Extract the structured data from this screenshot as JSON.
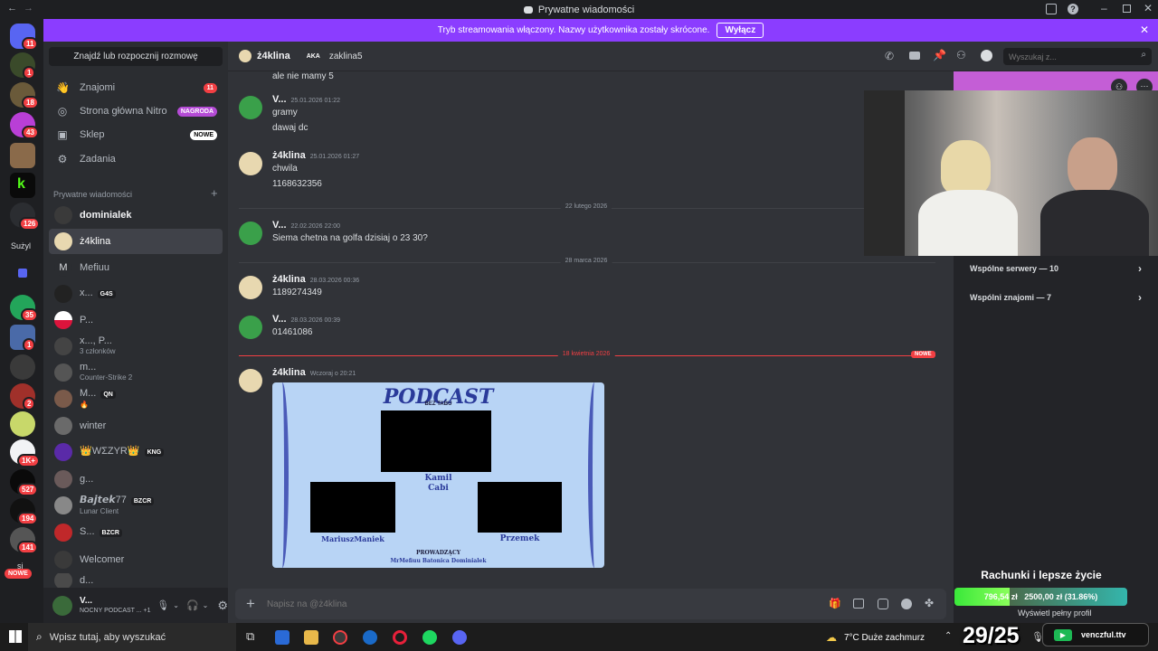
{
  "window": {
    "title": "Prywatne wiadomości"
  },
  "stream_bar": {
    "text": "Tryb streamowania włączony. Nazwy użytkownika zostały skrócone.",
    "button": "Wyłącz"
  },
  "guilds": {
    "badges": [
      "11",
      "1",
      "18",
      "43",
      "126",
      "35",
      "1",
      "2",
      "1K+",
      "527",
      "194",
      "141"
    ],
    "label": "Sużyl",
    "new_label": "NOWE",
    "si": "si"
  },
  "sidebar": {
    "search": "Znajdź lub rozpocznij rozmowę",
    "nav": [
      {
        "label": "Znajomi",
        "badge": "11",
        "icon": "friends-icon"
      },
      {
        "label": "Strona główna Nitro",
        "badge": "NAGRODA",
        "icon": "nitro-icon"
      },
      {
        "label": "Sklep",
        "badge": "NOWE",
        "icon": "shop-icon"
      },
      {
        "label": "Zadania",
        "badge": "",
        "icon": "quests-icon"
      }
    ],
    "dm_header": "Prywatne wiadomości",
    "dms": [
      {
        "name": "dominialek",
        "sub": "",
        "tag": ""
      },
      {
        "name": "ż4klina",
        "sub": "",
        "tag": ""
      },
      {
        "name": "Mefiuu",
        "sub": "",
        "tag": ""
      },
      {
        "name": "x...",
        "sub": "",
        "tag": "G4S"
      },
      {
        "name": "P...",
        "sub": "",
        "tag": ""
      },
      {
        "name": "x..., P...",
        "sub": "3 członków",
        "tag": ""
      },
      {
        "name": "m...",
        "sub": "Counter-Strike 2",
        "tag": ""
      },
      {
        "name": "M...",
        "sub": "🔥",
        "tag": "QN"
      },
      {
        "name": "winter",
        "sub": "",
        "tag": ""
      },
      {
        "name": "👑WΣZYR👑",
        "sub": "",
        "tag": "KNG"
      },
      {
        "name": "g...",
        "sub": "",
        "tag": ""
      },
      {
        "name": "𝘽𝙖𝙟𝙩𝙚𝙠77",
        "sub": "Lunar Client",
        "tag": "BZCR"
      },
      {
        "name": "S...",
        "sub": "",
        "tag": "BZCR"
      },
      {
        "name": "Welcomer",
        "sub": "",
        "tag": ""
      },
      {
        "name": "d...",
        "sub": "",
        "tag": ""
      }
    ],
    "user": {
      "name": "V...",
      "status": "NOCNY PODCAST ...",
      "extra": "+1"
    }
  },
  "header": {
    "name": "ż4klina",
    "aka": "AKA",
    "aka_name": "zaklina5",
    "search_placeholder": "Wyszukaj z..."
  },
  "messages": {
    "top_line": "ale nie mamy 5",
    "m1": {
      "author": "V...",
      "time": "25.01.2026 01:22",
      "lines": [
        "gramy",
        "dawaj dc"
      ]
    },
    "m2": {
      "author": "ż4klina",
      "time": "25.01.2026 01:27",
      "lines": [
        "chwila",
        "1168632356"
      ]
    },
    "d1": "22 lutego 2026",
    "m3": {
      "author": "V...",
      "time": "22.02.2026 22:00",
      "lines": [
        "Siema chetna na golfa dzisiaj o 23 30?"
      ]
    },
    "d2": "28 marca 2026",
    "m4": {
      "author": "ż4klina",
      "time": "28.03.2026 00:36",
      "lines": [
        "1189274349"
      ]
    },
    "m5": {
      "author": "V...",
      "time": "28.03.2026 00:39",
      "lines": [
        "01461086"
      ]
    },
    "d3": "18 kwietnia 2026",
    "d3_badge": "NOWE",
    "m6": {
      "author": "ż4klina",
      "time": "Wczoraj o 20:21"
    }
  },
  "podcast_image": {
    "title": "PODCAST",
    "subtitle": "BEZ TABU",
    "center": "Kamil\nCabi",
    "left": "MariuszManiek",
    "right": "Przemek",
    "hosts_label": "PROWADZĄCY",
    "hosts": "MrMefiuu  Batonica Dominialek"
  },
  "composer": {
    "placeholder": "Napisz na @ż4klina"
  },
  "profile": {
    "mutual_servers": "Wspólne serwery — 10",
    "mutual_friends": "Wspólni znajomi — 7"
  },
  "overlay": {
    "goal_title": "Rachunki i lepsze życie",
    "goal_current": "796,54 zł",
    "goal_target": "2500,00 zł (31.86%)",
    "goal_progress": 0.3186,
    "profile_link": "Wyświetl pełny profil",
    "channel": "venczful.ttv",
    "counter": "29/25"
  },
  "taskbar": {
    "search_placeholder": "Wpisz tutaj, aby wyszukać",
    "weather": "7°C  Duże zachmurz"
  },
  "colors": {
    "accent": "#5865f2",
    "stream": "#8b3dff",
    "danger": "#f23f43",
    "online": "#23a55a"
  }
}
